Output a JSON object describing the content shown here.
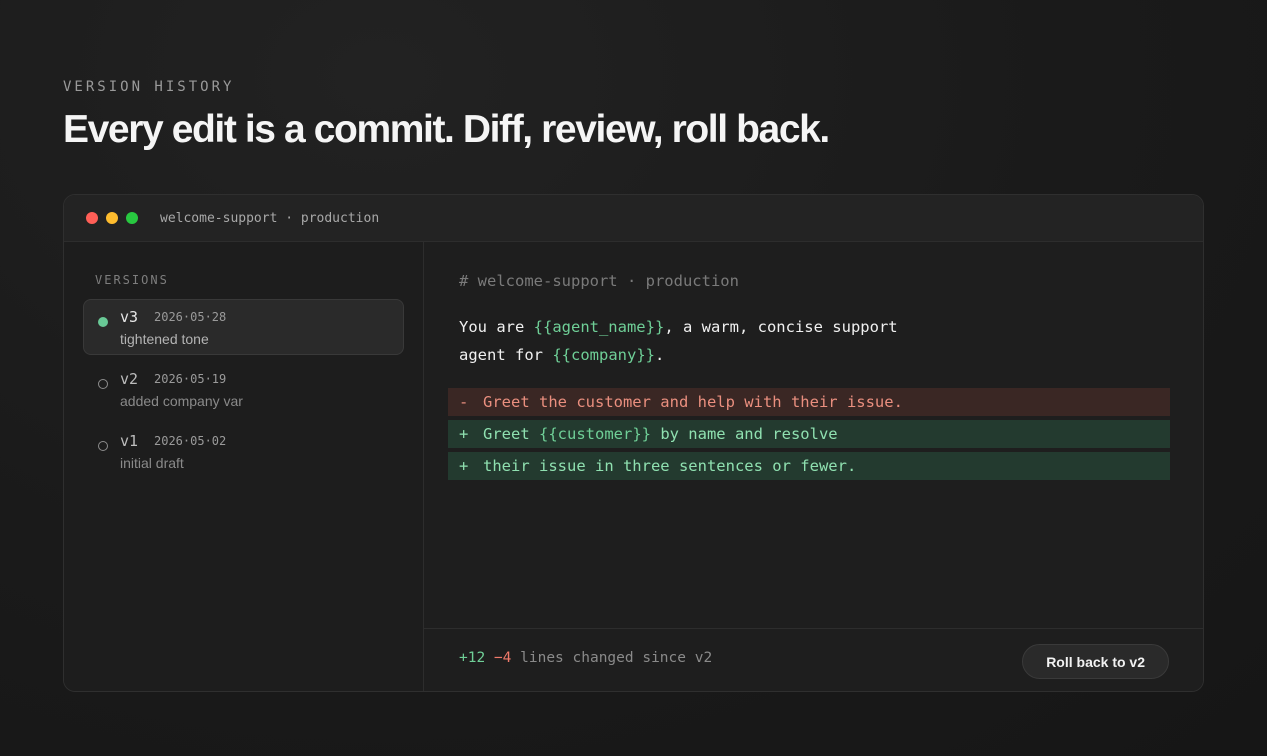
{
  "header": {
    "eyebrow": "VERSION HISTORY",
    "headline": "Every edit is a commit. Diff, review, roll back."
  },
  "window": {
    "title": "welcome-support · production",
    "controls": [
      {
        "name": "close",
        "color": "#ff5f57"
      },
      {
        "name": "minimize",
        "color": "#febc2e"
      },
      {
        "name": "maximize",
        "color": "#28c840"
      }
    ]
  },
  "sidebar": {
    "heading": "VERSIONS",
    "versions": [
      {
        "name": "v3",
        "date": "2026·05·28",
        "note": "tightened tone",
        "active": true
      },
      {
        "name": "v2",
        "date": "2026·05·19",
        "note": "added company var",
        "active": false
      },
      {
        "name": "v1",
        "date": "2026·05·02",
        "note": "initial draft",
        "active": false
      }
    ]
  },
  "editor": {
    "comment": "# welcome-support · production",
    "line1": {
      "pre": "You are ",
      "var": "{{agent_name}}",
      "post": ", a warm, concise support"
    },
    "line2": {
      "pre": "agent for ",
      "var": "{{company}}",
      "post": "."
    },
    "diff": {
      "removed": {
        "sign": "-",
        "text": "Greet the customer and help with their issue."
      },
      "added1": {
        "sign": "+",
        "pre": "Greet ",
        "var": "{{customer}}",
        "post": " by name and resolve"
      },
      "added2": {
        "sign": "+",
        "text": "their issue in three sentences or fewer."
      }
    }
  },
  "footer": {
    "additions": "+12",
    "deletions": "−4",
    "summary": " lines changed since v2",
    "rollback_label": "Roll back to v2"
  },
  "colors": {
    "accent_green": "#6fcf97",
    "accent_red": "#f07a6a",
    "background": "#1a1a1a"
  }
}
